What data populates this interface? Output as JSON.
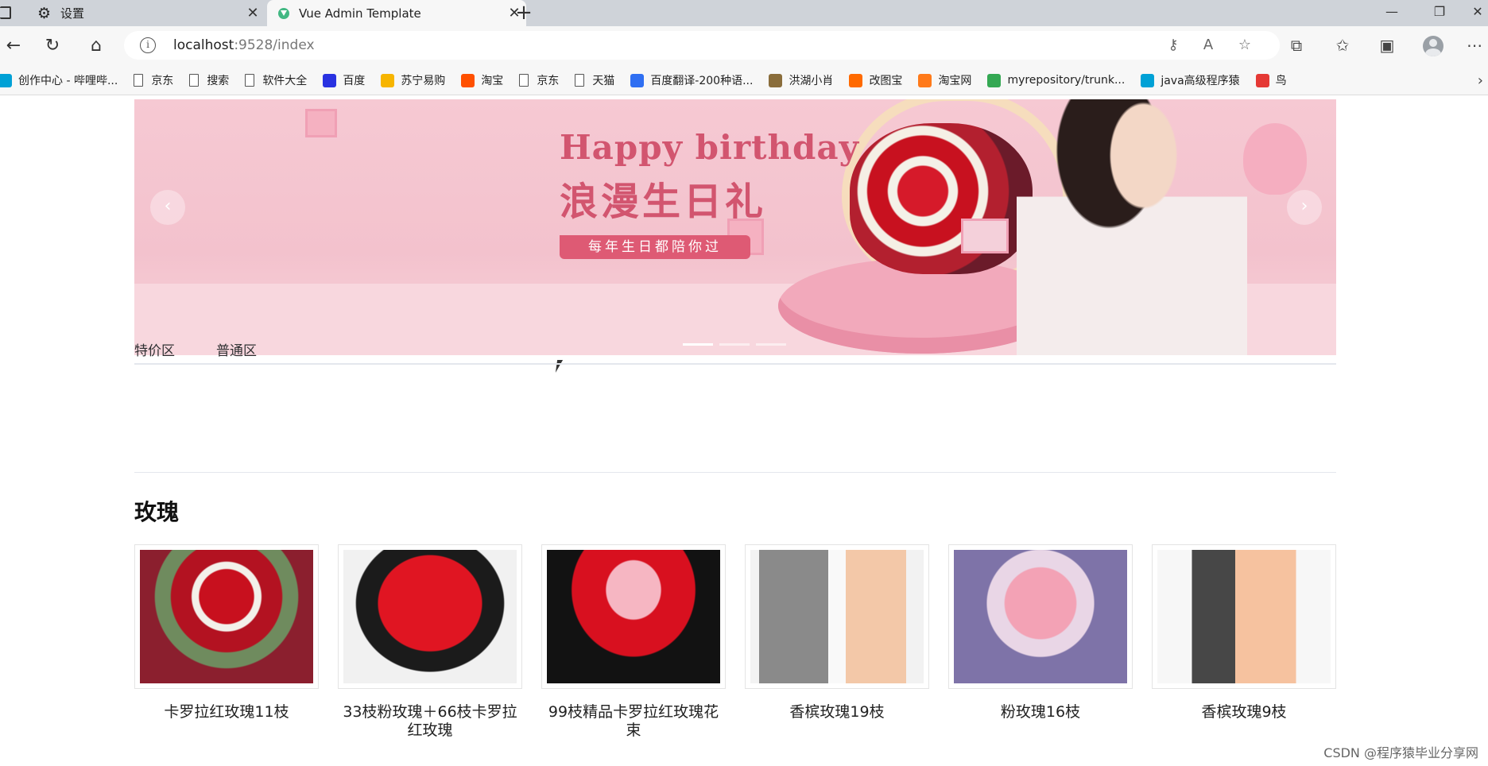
{
  "browser": {
    "tabs": [
      {
        "title": "设置",
        "icon": "gear-icon",
        "active": false
      },
      {
        "title": "Vue Admin Template",
        "icon": "vue-icon",
        "active": true
      }
    ],
    "address": {
      "host": "localhost",
      "path": ":9528/index"
    },
    "bookmarks": [
      {
        "label": "创作中心 - 哔哩哔...",
        "icon": "bilibili-icon",
        "color": "#00a1d6"
      },
      {
        "label": "京东",
        "icon": "page-icon"
      },
      {
        "label": "搜索",
        "icon": "page-icon"
      },
      {
        "label": "软件大全",
        "icon": "page-icon"
      },
      {
        "label": "百度",
        "icon": "baidu-icon",
        "color": "#2932e1"
      },
      {
        "label": "苏宁易购",
        "icon": "suning-icon",
        "color": "#f7b500"
      },
      {
        "label": "淘宝",
        "icon": "taobao-icon",
        "color": "#ff5000"
      },
      {
        "label": "京东",
        "icon": "page-icon"
      },
      {
        "label": "天猫",
        "icon": "page-icon"
      },
      {
        "label": "百度翻译-200种语...",
        "icon": "translate-icon",
        "color": "#2f6ff2"
      },
      {
        "label": "洪湖小肖",
        "icon": "bird-icon",
        "color": "#8a6d3b"
      },
      {
        "label": "改图宝",
        "icon": "gaitubao-icon",
        "color": "#ff6a00"
      },
      {
        "label": "淘宝网",
        "icon": "taobao-icon",
        "color": "#ff7a1a"
      },
      {
        "label": "myrepository/trunk...",
        "icon": "chrome-icon",
        "color": "#34a853"
      },
      {
        "label": "java高级程序猿",
        "icon": "bilibili-icon",
        "color": "#00a1d6"
      },
      {
        "label": "鸟",
        "icon": "bird-icon",
        "color": "#e53935"
      }
    ]
  },
  "banner": {
    "title_en": "Happy birthday",
    "title_cn": "浪漫生日礼",
    "tagline": "每年生日都陪你过",
    "prev": "‹",
    "next": "›",
    "slides": 3,
    "active_slide": 1
  },
  "page_tabs": [
    "特价区",
    "普通区"
  ],
  "section": {
    "title": "玫瑰"
  },
  "products": [
    {
      "name": "卡罗拉红玫瑰11枝"
    },
    {
      "name": "33枝粉玫瑰＋66枝卡罗拉红玫瑰"
    },
    {
      "name": "99枝精品卡罗拉红玫瑰花束"
    },
    {
      "name": "香槟玫瑰19枝"
    },
    {
      "name": "粉玫瑰16枝"
    },
    {
      "name": "香槟玫瑰9枝"
    }
  ],
  "watermark": "CSDN @程序猿毕业分享网"
}
